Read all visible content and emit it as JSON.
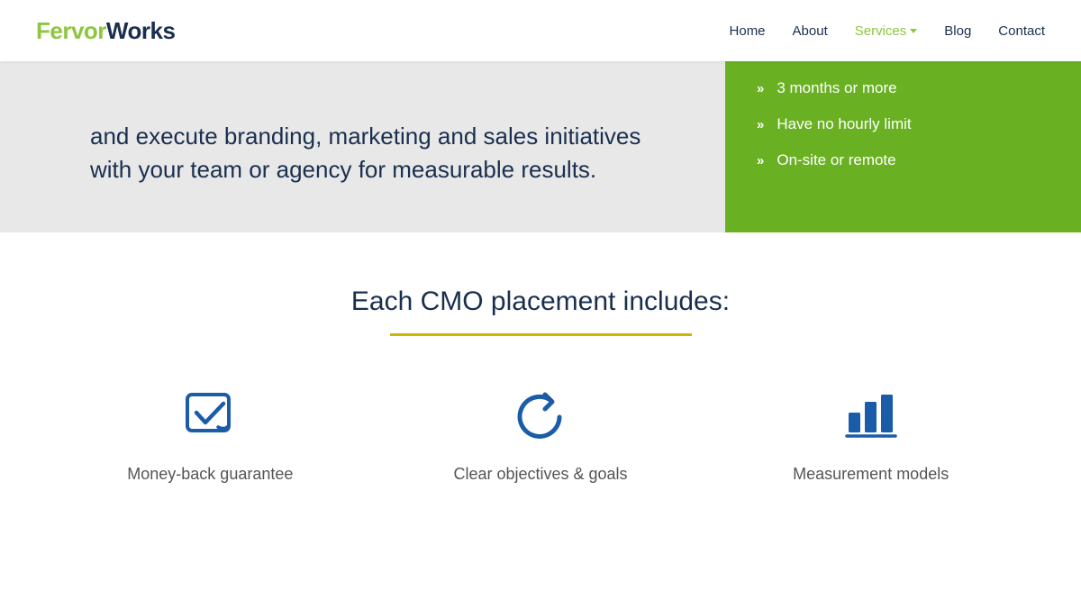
{
  "header": {
    "logo_fervor": "Fervor",
    "logo_works": "Works",
    "nav": {
      "home": "Home",
      "about": "About",
      "services": "Services",
      "blog": "Blog",
      "contact": "Contact"
    }
  },
  "hero": {
    "left_text": "and execute branding, marketing and sales initiatives with your team or agency for measurable results.",
    "bullets": [
      {
        "text": "3 months or more"
      },
      {
        "text": "Have no hourly limit"
      },
      {
        "text": "On-site or remote"
      }
    ]
  },
  "cmo": {
    "title": "Each CMO placement includes:",
    "features": [
      {
        "label": "Money-back guarantee",
        "icon": "checkmark-icon"
      },
      {
        "label": "Clear objectives & goals",
        "icon": "refresh-icon"
      },
      {
        "label": "Measurement models",
        "icon": "chart-icon"
      }
    ]
  }
}
